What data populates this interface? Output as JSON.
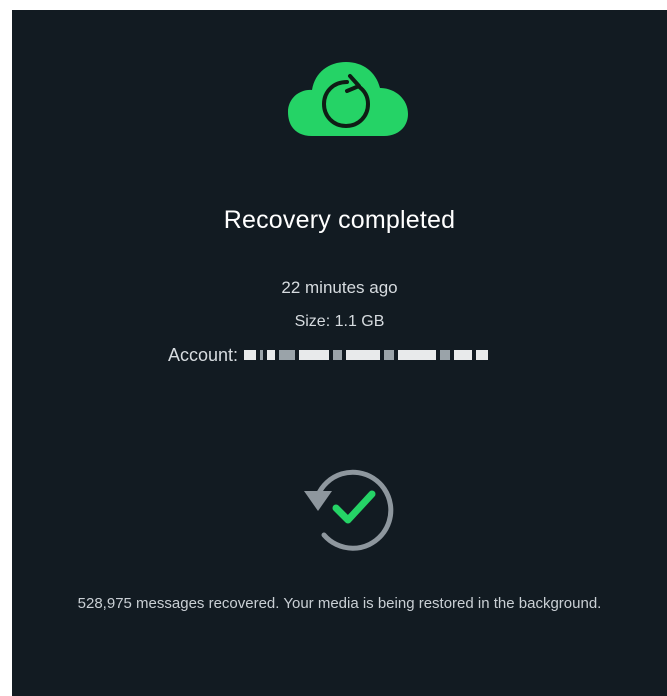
{
  "status": {
    "title": "Recovery completed",
    "time": "22 minutes ago",
    "size": "Size: 1.1 GB",
    "account_label": "Account:",
    "footer": "528,975 messages recovered. Your media is being restored in the background."
  },
  "icons": {
    "top": "cloud-sync-icon",
    "middle": "restore-check-icon"
  },
  "colors": {
    "background": "#121b22",
    "accent": "#25d366",
    "text": "#ffffff",
    "muted": "#d6dbdf"
  }
}
